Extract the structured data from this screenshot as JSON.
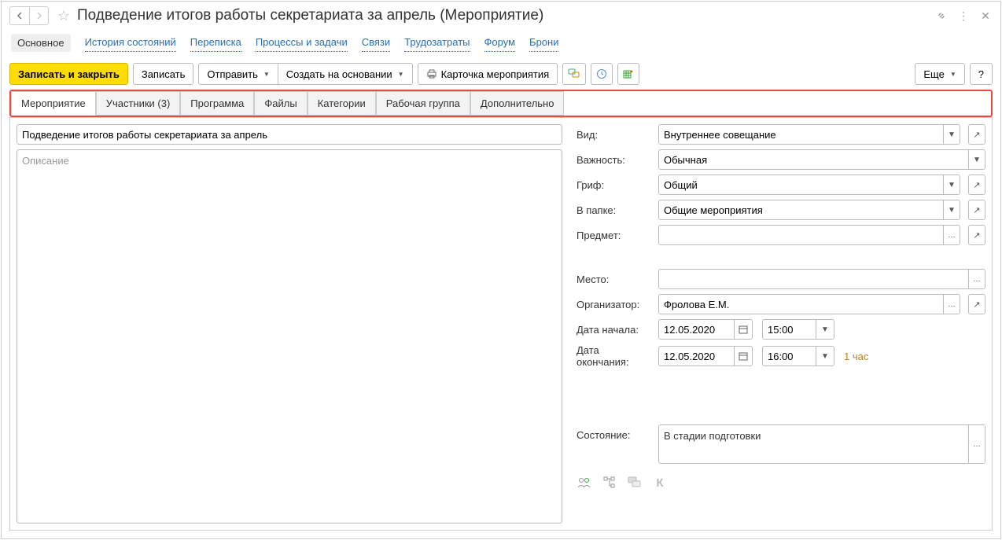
{
  "header": {
    "title": "Подведение итогов работы секретариата за апрель (Мероприятие)"
  },
  "links": {
    "active": "Основное",
    "items": [
      "История состояний",
      "Переписка",
      "Процессы и задачи",
      "Связи",
      "Трудозатраты",
      "Форум",
      "Брони"
    ]
  },
  "toolbar": {
    "save_close": "Записать и закрыть",
    "save": "Записать",
    "send": "Отправить",
    "create_from": "Создать на основании",
    "card": "Карточка мероприятия",
    "more": "Еще",
    "help": "?"
  },
  "tabs": [
    "Мероприятие",
    "Участники (3)",
    "Программа",
    "Файлы",
    "Категории",
    "Рабочая группа",
    "Дополнительно"
  ],
  "form": {
    "name_value": "Подведение итогов работы секретариата за апрель",
    "desc_placeholder": "Описание",
    "labels": {
      "type": "Вид:",
      "importance": "Важность:",
      "grif": "Гриф:",
      "folder": "В папке:",
      "subject": "Предмет:",
      "place": "Место:",
      "organizer": "Организатор:",
      "start": "Дата начала:",
      "end": "Дата окончания:",
      "state": "Состояние:"
    },
    "type": "Внутреннее совещание",
    "importance": "Обычная",
    "grif": "Общий",
    "folder": "Общие мероприятия",
    "subject": "",
    "place": "",
    "organizer": "Фролова Е.М.",
    "start_date": "12.05.2020",
    "start_time": "15:00",
    "end_date": "12.05.2020",
    "end_time": "16:00",
    "duration": "1 час",
    "state": "В стадии подготовки"
  }
}
